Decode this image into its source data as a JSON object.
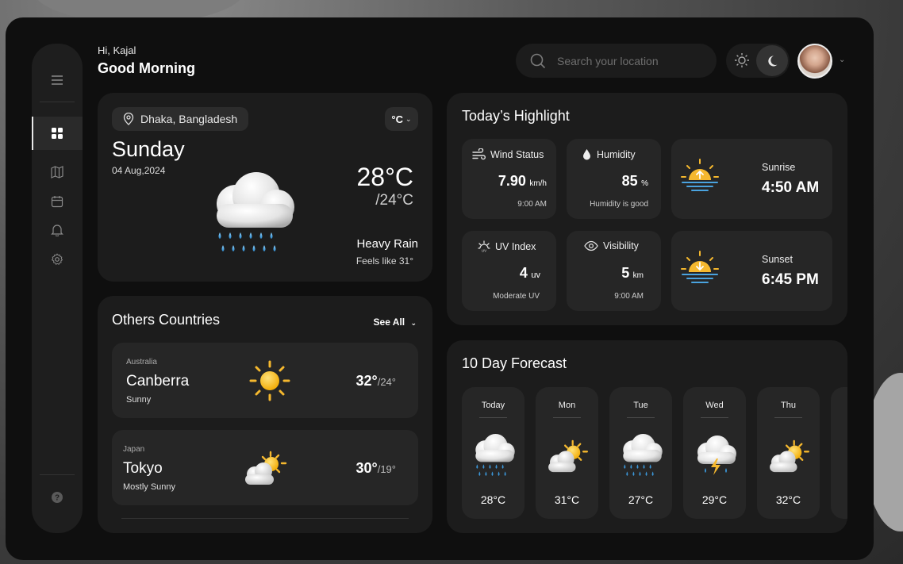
{
  "header": {
    "greeting_small": "Hi, Kajal",
    "greeting_big": "Good Morning",
    "search_placeholder": "Search your location"
  },
  "current": {
    "location": "Dhaka, Bangladesh",
    "unit": "°C",
    "day": "Sunday",
    "date": "04 Aug,2024",
    "temp": "28°C",
    "low": "/24°C",
    "condition": "Heavy Rain",
    "feels_like": "Feels like 31°"
  },
  "others": {
    "title": "Others Countries",
    "see_all": "See All",
    "items": [
      {
        "country": "Australia",
        "city": "Canberra",
        "condition": "Sunny",
        "high": "32°",
        "low": "/24°",
        "icon": "sun-icon"
      },
      {
        "country": "Japan",
        "city": "Tokyo",
        "condition": "Mostly Sunny",
        "high": "30°",
        "low": "/19°",
        "icon": "partly-cloudy-icon"
      }
    ]
  },
  "highlight": {
    "title": "Today’s Highlight",
    "wind": {
      "label": "Wind Status",
      "value": "7.90",
      "unit": "km/h",
      "note": "9:00 AM"
    },
    "humidity": {
      "label": "Humidity",
      "value": "85",
      "unit": "%",
      "note": "Humidity is good"
    },
    "uv": {
      "label": "UV Index",
      "value": "4",
      "unit": "uv",
      "note": "Moderate UV"
    },
    "visibility": {
      "label": "Visibility",
      "value": "5",
      "unit": "km",
      "note": "9:00 AM"
    },
    "sunrise": {
      "label": "Sunrise",
      "value": "4:50 AM"
    },
    "sunset": {
      "label": "Sunset",
      "value": "6:45 PM"
    }
  },
  "forecast": {
    "title": "10 Day Forecast",
    "days": [
      {
        "day": "Today",
        "temp": "28°C",
        "icon": "rain-cloud-icon"
      },
      {
        "day": "Mon",
        "temp": "31°C",
        "icon": "partly-cloudy-icon"
      },
      {
        "day": "Tue",
        "temp": "27°C",
        "icon": "rain-cloud-icon"
      },
      {
        "day": "Wed",
        "temp": "29°C",
        "icon": "thunderstorm-icon"
      },
      {
        "day": "Thu",
        "temp": "32°C",
        "icon": "partly-cloudy-icon"
      }
    ]
  },
  "colors": {
    "sun": "#f5b82e",
    "water": "#4aa3df",
    "bg": "#0f0f0f",
    "card": "#1c1c1c"
  }
}
